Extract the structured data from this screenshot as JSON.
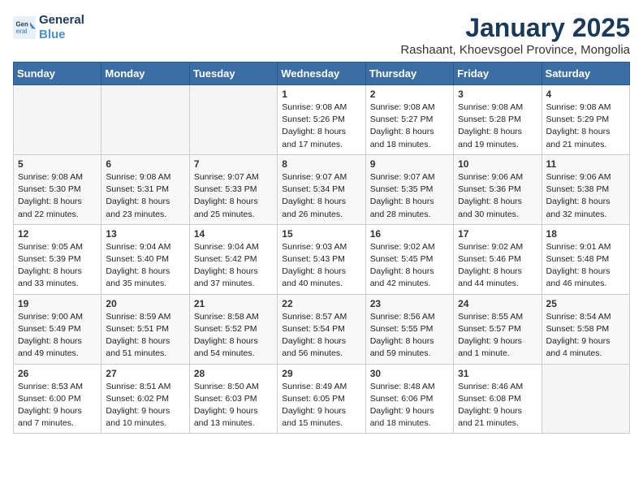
{
  "logo": {
    "line1": "General",
    "line2": "Blue"
  },
  "title": "January 2025",
  "location": "Rashaant, Khoevsgoel Province, Mongolia",
  "days_of_week": [
    "Sunday",
    "Monday",
    "Tuesday",
    "Wednesday",
    "Thursday",
    "Friday",
    "Saturday"
  ],
  "weeks": [
    [
      {
        "day": "",
        "empty": true
      },
      {
        "day": "",
        "empty": true
      },
      {
        "day": "",
        "empty": true
      },
      {
        "day": "1",
        "sunrise": "9:08 AM",
        "sunset": "5:26 PM",
        "daylight": "8 hours and 17 minutes."
      },
      {
        "day": "2",
        "sunrise": "9:08 AM",
        "sunset": "5:27 PM",
        "daylight": "8 hours and 18 minutes."
      },
      {
        "day": "3",
        "sunrise": "9:08 AM",
        "sunset": "5:28 PM",
        "daylight": "8 hours and 19 minutes."
      },
      {
        "day": "4",
        "sunrise": "9:08 AM",
        "sunset": "5:29 PM",
        "daylight": "8 hours and 21 minutes."
      }
    ],
    [
      {
        "day": "5",
        "sunrise": "9:08 AM",
        "sunset": "5:30 PM",
        "daylight": "8 hours and 22 minutes."
      },
      {
        "day": "6",
        "sunrise": "9:08 AM",
        "sunset": "5:31 PM",
        "daylight": "8 hours and 23 minutes."
      },
      {
        "day": "7",
        "sunrise": "9:07 AM",
        "sunset": "5:33 PM",
        "daylight": "8 hours and 25 minutes."
      },
      {
        "day": "8",
        "sunrise": "9:07 AM",
        "sunset": "5:34 PM",
        "daylight": "8 hours and 26 minutes."
      },
      {
        "day": "9",
        "sunrise": "9:07 AM",
        "sunset": "5:35 PM",
        "daylight": "8 hours and 28 minutes."
      },
      {
        "day": "10",
        "sunrise": "9:06 AM",
        "sunset": "5:36 PM",
        "daylight": "8 hours and 30 minutes."
      },
      {
        "day": "11",
        "sunrise": "9:06 AM",
        "sunset": "5:38 PM",
        "daylight": "8 hours and 32 minutes."
      }
    ],
    [
      {
        "day": "12",
        "sunrise": "9:05 AM",
        "sunset": "5:39 PM",
        "daylight": "8 hours and 33 minutes."
      },
      {
        "day": "13",
        "sunrise": "9:04 AM",
        "sunset": "5:40 PM",
        "daylight": "8 hours and 35 minutes."
      },
      {
        "day": "14",
        "sunrise": "9:04 AM",
        "sunset": "5:42 PM",
        "daylight": "8 hours and 37 minutes."
      },
      {
        "day": "15",
        "sunrise": "9:03 AM",
        "sunset": "5:43 PM",
        "daylight": "8 hours and 40 minutes."
      },
      {
        "day": "16",
        "sunrise": "9:02 AM",
        "sunset": "5:45 PM",
        "daylight": "8 hours and 42 minutes."
      },
      {
        "day": "17",
        "sunrise": "9:02 AM",
        "sunset": "5:46 PM",
        "daylight": "8 hours and 44 minutes."
      },
      {
        "day": "18",
        "sunrise": "9:01 AM",
        "sunset": "5:48 PM",
        "daylight": "8 hours and 46 minutes."
      }
    ],
    [
      {
        "day": "19",
        "sunrise": "9:00 AM",
        "sunset": "5:49 PM",
        "daylight": "8 hours and 49 minutes."
      },
      {
        "day": "20",
        "sunrise": "8:59 AM",
        "sunset": "5:51 PM",
        "daylight": "8 hours and 51 minutes."
      },
      {
        "day": "21",
        "sunrise": "8:58 AM",
        "sunset": "5:52 PM",
        "daylight": "8 hours and 54 minutes."
      },
      {
        "day": "22",
        "sunrise": "8:57 AM",
        "sunset": "5:54 PM",
        "daylight": "8 hours and 56 minutes."
      },
      {
        "day": "23",
        "sunrise": "8:56 AM",
        "sunset": "5:55 PM",
        "daylight": "8 hours and 59 minutes."
      },
      {
        "day": "24",
        "sunrise": "8:55 AM",
        "sunset": "5:57 PM",
        "daylight": "9 hours and 1 minute."
      },
      {
        "day": "25",
        "sunrise": "8:54 AM",
        "sunset": "5:58 PM",
        "daylight": "9 hours and 4 minutes."
      }
    ],
    [
      {
        "day": "26",
        "sunrise": "8:53 AM",
        "sunset": "6:00 PM",
        "daylight": "9 hours and 7 minutes."
      },
      {
        "day": "27",
        "sunrise": "8:51 AM",
        "sunset": "6:02 PM",
        "daylight": "9 hours and 10 minutes."
      },
      {
        "day": "28",
        "sunrise": "8:50 AM",
        "sunset": "6:03 PM",
        "daylight": "9 hours and 13 minutes."
      },
      {
        "day": "29",
        "sunrise": "8:49 AM",
        "sunset": "6:05 PM",
        "daylight": "9 hours and 15 minutes."
      },
      {
        "day": "30",
        "sunrise": "8:48 AM",
        "sunset": "6:06 PM",
        "daylight": "9 hours and 18 minutes."
      },
      {
        "day": "31",
        "sunrise": "8:46 AM",
        "sunset": "6:08 PM",
        "daylight": "9 hours and 21 minutes."
      },
      {
        "day": "",
        "empty": true
      }
    ]
  ]
}
